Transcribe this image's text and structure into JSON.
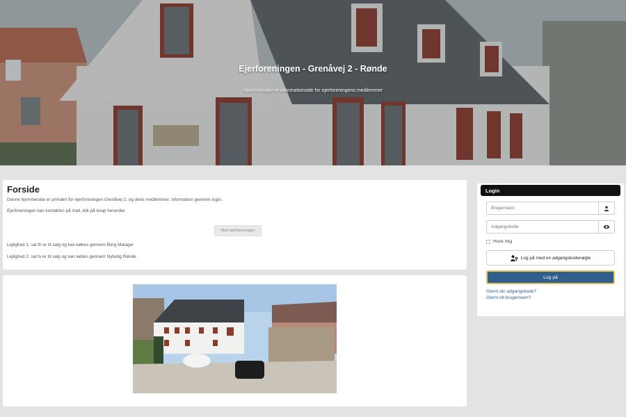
{
  "hero": {
    "title": "Ejerforeningen - Grenåvej 2 - Rønde",
    "subtitle": "Hjemmesiden er informationside for ejerforeningens medlemmer"
  },
  "main": {
    "heading": "Forside",
    "intro": "Denne hjemmeside er primært for ejerforeningen Grenåvej 2, og dens medlemmer, information gennem login.",
    "contact": "Ejerforeningen kan kontaktes på mail, klik på knap herunder",
    "mail_button": "Mail ejerforeningen",
    "sale1": "Lejlighed 1. sal th er til salg og kan købes gennem Berg Malager",
    "sale2": "Lejlighed 2. sal tv er til salg og kan købes gennem Nybolig Rønde"
  },
  "login": {
    "title": "Login",
    "username_placeholder": "Brugernavn",
    "password_placeholder": "Adgangskode",
    "remember_label": "Husk mig",
    "passkey_button": "Log på med en adgangskodenøgle",
    "submit_button": "Log på",
    "forgot_password": "Glemt din adgangskode?",
    "forgot_username": "Glemt dit brugernavn?",
    "icons": {
      "username": "user-icon",
      "password": "eye-icon",
      "passkey": "user-key-icon"
    }
  },
  "colors": {
    "primary": "#2f5f8a",
    "focus_border": "#e8c25a",
    "login_header": "#111111",
    "page_bg": "#e3e3e3"
  }
}
